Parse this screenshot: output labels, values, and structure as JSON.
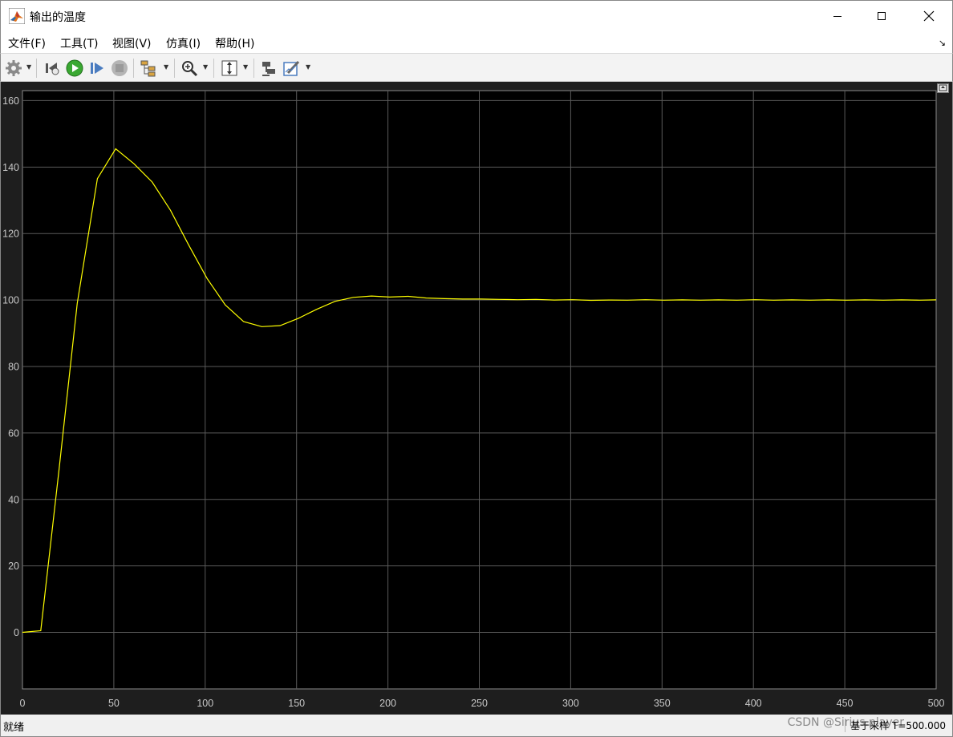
{
  "window": {
    "title": "输出的温度"
  },
  "menu": [
    {
      "label": "文件(F)"
    },
    {
      "label": "工具(T)"
    },
    {
      "label": "视图(V)"
    },
    {
      "label": "仿真(I)"
    },
    {
      "label": "帮助(H)"
    }
  ],
  "toolbar": {
    "icons": [
      "gear-icon",
      "step-back-icon",
      "run-icon",
      "step-forward-icon",
      "stop-icon",
      "signal-hierarchy-icon",
      "zoom-in-icon",
      "autoscale-icon",
      "highlight-block-icon",
      "edit-style-icon"
    ]
  },
  "colors": {
    "plot_bg": "#000000",
    "frame_bg": "#1e1e1e",
    "grid": "#5a5a5a",
    "trace": "#ffff00",
    "tick_text": "#c8c8c8",
    "run_green": "#3aa832"
  },
  "chart_data": {
    "type": "line",
    "xlim": [
      0,
      500
    ],
    "ylim": [
      -17,
      163
    ],
    "grid": true,
    "xticks": [
      0,
      50,
      100,
      150,
      200,
      250,
      300,
      350,
      400,
      450,
      500
    ],
    "yticks": [
      0,
      20,
      40,
      60,
      80,
      100,
      120,
      140,
      160
    ],
    "series": [
      {
        "x": [
          0,
          10,
          20,
          30,
          41,
          51,
          61,
          71,
          81,
          91,
          101,
          111,
          121,
          131,
          141,
          151,
          161,
          171,
          181,
          191,
          201,
          211,
          221,
          231,
          241,
          251,
          261,
          271,
          281,
          291,
          301,
          311,
          321,
          331,
          341,
          351,
          361,
          371,
          381,
          391,
          401,
          411,
          421,
          431,
          441,
          451,
          461,
          471,
          481,
          491,
          500
        ],
        "y": [
          0,
          0.5,
          49,
          99,
          136.5,
          145.5,
          141,
          135.5,
          127,
          116.5,
          106.5,
          98.5,
          93.5,
          92,
          92.3,
          94.5,
          97.2,
          99.6,
          100.8,
          101.2,
          100.9,
          101.1,
          100.6,
          100.4,
          100.3,
          100.3,
          100.2,
          100.1,
          100.2,
          100.0,
          100.1,
          99.9,
          100.0,
          99.95,
          100.1,
          99.95,
          100.05,
          99.95,
          100.05,
          99.95,
          100.1,
          99.95,
          100.05,
          99.95,
          100.05,
          99.95,
          100.05,
          99.95,
          100.05,
          99.95,
          100.05
        ]
      }
    ]
  },
  "status": {
    "left": "就绪",
    "right": "基于采样  T=500.000",
    "watermark": "CSDN @Sirius.player"
  }
}
